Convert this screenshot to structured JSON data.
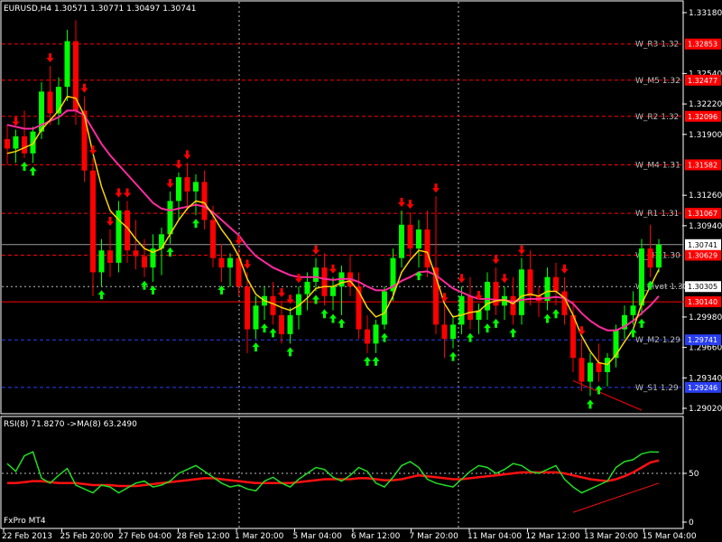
{
  "header": {
    "symbol_info": "EURUSD,H4  1.30571 1.30771 1.30497 1.30741",
    "rsi_info": "RSI(8) 71.8270   ->MA(8) 63.2490",
    "broker": "FxPro MT4"
  },
  "colors": {
    "bull": "#00ff00",
    "bear": "#ff0000",
    "resistance": "#ff0000",
    "support": "#2a3ef0",
    "ma_fast": "#ffd400",
    "ma_slow": "#ff2aa0",
    "rsi_line": "#22dd22",
    "rsi_ma": "#ff1010",
    "grid": "#7a7a7a"
  },
  "chart_data": [
    {
      "type": "candlestick",
      "symbol": "EURUSD",
      "timeframe": "H4",
      "ohlc_current": {
        "open": 1.30571,
        "high": 1.30771,
        "low": 1.30497,
        "close": 1.30741
      },
      "ylim": [
        1.2902,
        1.3318
      ],
      "y_ticks": [
        "1.33180",
        "1.32540",
        "1.32220",
        "1.31900",
        "1.31260",
        "1.30940",
        "1.29980",
        "1.29660",
        "1.29340",
        "1.29020"
      ],
      "x_ticks": [
        "22 Feb 2013",
        "25 Feb 20:00",
        "27 Feb 04:00",
        "28 Feb 12:00",
        "1 Mar 20:00",
        "5 Mar 04:00",
        "6 Mar 12:00",
        "7 Mar 20:00",
        "11 Mar 04:00",
        "12 Mar 12:00",
        "13 Mar 20:00",
        "15 Mar 04:00"
      ],
      "levels": [
        {
          "name": "W_R3 1.32",
          "price": 1.3285,
          "badge": "1.32853",
          "kind": "resistance"
        },
        {
          "name": "W_M5 1.32",
          "price": 1.3247,
          "badge": "1.32477",
          "kind": "resistance"
        },
        {
          "name": "W_R2 1.32",
          "price": 1.3209,
          "badge": "1.32096",
          "kind": "resistance"
        },
        {
          "name": "W_M4 1.31",
          "price": 1.3158,
          "badge": "1.31582",
          "kind": "resistance"
        },
        {
          "name": "W_R1 1.31",
          "price": 1.3107,
          "badge": "1.31067",
          "kind": "resistance"
        },
        {
          "name": "W_M3 1.30",
          "price": 1.3063,
          "badge": "1.30629",
          "kind": "resistance"
        },
        {
          "name": "W_Pivot 1.30",
          "price": 1.303,
          "badge": "1.30305",
          "kind": "pivot"
        },
        {
          "name": "",
          "price": 1.3014,
          "badge": "1.30140",
          "kind": "resistance"
        },
        {
          "name": "W_M2 1.29",
          "price": 1.2974,
          "badge": "1.29741",
          "kind": "support"
        },
        {
          "name": "W_S1 1.29",
          "price": 1.2924,
          "badge": "1.29246",
          "kind": "support"
        }
      ],
      "current_price": {
        "price": 1.30741,
        "badge": "1.30741"
      },
      "candles": [
        {
          "o": 1.3185,
          "h": 1.32,
          "l": 1.3158,
          "c": 1.3175
        },
        {
          "o": 1.3175,
          "h": 1.3195,
          "l": 1.316,
          "c": 1.3188
        },
        {
          "o": 1.3188,
          "h": 1.3215,
          "l": 1.3165,
          "c": 1.317
        },
        {
          "o": 1.317,
          "h": 1.3198,
          "l": 1.316,
          "c": 1.3193
        },
        {
          "o": 1.3193,
          "h": 1.3245,
          "l": 1.3185,
          "c": 1.3235
        },
        {
          "o": 1.3235,
          "h": 1.3262,
          "l": 1.32,
          "c": 1.3212
        },
        {
          "o": 1.3212,
          "h": 1.325,
          "l": 1.32,
          "c": 1.324
        },
        {
          "o": 1.324,
          "h": 1.33,
          "l": 1.3225,
          "c": 1.3288
        },
        {
          "o": 1.3288,
          "h": 1.331,
          "l": 1.32,
          "c": 1.3215
        },
        {
          "o": 1.3215,
          "h": 1.323,
          "l": 1.314,
          "c": 1.3152
        },
        {
          "o": 1.3152,
          "h": 1.3165,
          "l": 1.302,
          "c": 1.3045
        },
        {
          "o": 1.3045,
          "h": 1.308,
          "l": 1.303,
          "c": 1.3068
        },
        {
          "o": 1.3068,
          "h": 1.309,
          "l": 1.304,
          "c": 1.3055
        },
        {
          "o": 1.3055,
          "h": 1.312,
          "l": 1.3045,
          "c": 1.311
        },
        {
          "o": 1.311,
          "h": 1.312,
          "l": 1.3055,
          "c": 1.3068
        },
        {
          "o": 1.3068,
          "h": 1.31,
          "l": 1.3048,
          "c": 1.3062
        },
        {
          "o": 1.3062,
          "h": 1.308,
          "l": 1.304,
          "c": 1.305
        },
        {
          "o": 1.305,
          "h": 1.3085,
          "l": 1.3035,
          "c": 1.307
        },
        {
          "o": 1.307,
          "h": 1.3092,
          "l": 1.3042,
          "c": 1.3085
        },
        {
          "o": 1.3085,
          "h": 1.313,
          "l": 1.3075,
          "c": 1.312
        },
        {
          "o": 1.312,
          "h": 1.315,
          "l": 1.31,
          "c": 1.3145
        },
        {
          "o": 1.3145,
          "h": 1.316,
          "l": 1.311,
          "c": 1.313
        },
        {
          "o": 1.313,
          "h": 1.3148,
          "l": 1.3105,
          "c": 1.314
        },
        {
          "o": 1.314,
          "h": 1.3152,
          "l": 1.309,
          "c": 1.31
        },
        {
          "o": 1.31,
          "h": 1.3115,
          "l": 1.305,
          "c": 1.306
        },
        {
          "o": 1.306,
          "h": 1.3075,
          "l": 1.3035,
          "c": 1.305
        },
        {
          "o": 1.305,
          "h": 1.3065,
          "l": 1.303,
          "c": 1.306
        },
        {
          "o": 1.306,
          "h": 1.307,
          "l": 1.302,
          "c": 1.303
        },
        {
          "o": 1.303,
          "h": 1.3045,
          "l": 1.296,
          "c": 1.2985
        },
        {
          "o": 1.2985,
          "h": 1.302,
          "l": 1.2975,
          "c": 1.301
        },
        {
          "o": 1.301,
          "h": 1.303,
          "l": 1.2995,
          "c": 1.302
        },
        {
          "o": 1.302,
          "h": 1.3035,
          "l": 1.299,
          "c": 1.3
        },
        {
          "o": 1.3,
          "h": 1.3015,
          "l": 1.297,
          "c": 1.298
        },
        {
          "o": 1.298,
          "h": 1.3008,
          "l": 1.297,
          "c": 1.3
        },
        {
          "o": 1.3,
          "h": 1.303,
          "l": 1.2985,
          "c": 1.3022
        },
        {
          "o": 1.3022,
          "h": 1.3045,
          "l": 1.3005,
          "c": 1.3035
        },
        {
          "o": 1.3035,
          "h": 1.306,
          "l": 1.3025,
          "c": 1.305
        },
        {
          "o": 1.305,
          "h": 1.3065,
          "l": 1.301,
          "c": 1.302
        },
        {
          "o": 1.302,
          "h": 1.304,
          "l": 1.3005,
          "c": 1.303
        },
        {
          "o": 1.303,
          "h": 1.3052,
          "l": 1.3,
          "c": 1.3045
        },
        {
          "o": 1.3045,
          "h": 1.3062,
          "l": 1.302,
          "c": 1.303
        },
        {
          "o": 1.303,
          "h": 1.3045,
          "l": 1.2975,
          "c": 1.2985
        },
        {
          "o": 1.2985,
          "h": 1.3,
          "l": 1.296,
          "c": 1.297
        },
        {
          "o": 1.297,
          "h": 1.2995,
          "l": 1.296,
          "c": 1.299
        },
        {
          "o": 1.299,
          "h": 1.303,
          "l": 1.2985,
          "c": 1.3025
        },
        {
          "o": 1.3025,
          "h": 1.307,
          "l": 1.3015,
          "c": 1.306
        },
        {
          "o": 1.306,
          "h": 1.311,
          "l": 1.305,
          "c": 1.3095
        },
        {
          "o": 1.3095,
          "h": 1.3108,
          "l": 1.306,
          "c": 1.307
        },
        {
          "o": 1.307,
          "h": 1.31,
          "l": 1.305,
          "c": 1.309
        },
        {
          "o": 1.309,
          "h": 1.311,
          "l": 1.304,
          "c": 1.305
        },
        {
          "o": 1.305,
          "h": 1.3125,
          "l": 1.298,
          "c": 1.299
        },
        {
          "o": 1.299,
          "h": 1.301,
          "l": 1.2955,
          "c": 1.2975
        },
        {
          "o": 1.2975,
          "h": 1.3,
          "l": 1.2965,
          "c": 1.299
        },
        {
          "o": 1.299,
          "h": 1.303,
          "l": 1.298,
          "c": 1.302
        },
        {
          "o": 1.302,
          "h": 1.304,
          "l": 1.2985,
          "c": 1.2995
        },
        {
          "o": 1.2995,
          "h": 1.3012,
          "l": 1.298,
          "c": 1.3005
        },
        {
          "o": 1.3005,
          "h": 1.3045,
          "l": 1.2995,
          "c": 1.3035
        },
        {
          "o": 1.3035,
          "h": 1.305,
          "l": 1.3,
          "c": 1.301
        },
        {
          "o": 1.301,
          "h": 1.303,
          "l": 1.2995,
          "c": 1.302
        },
        {
          "o": 1.302,
          "h": 1.304,
          "l": 1.299,
          "c": 1.3
        },
        {
          "o": 1.3,
          "h": 1.306,
          "l": 1.299,
          "c": 1.3048
        },
        {
          "o": 1.3048,
          "h": 1.3068,
          "l": 1.301,
          "c": 1.302
        },
        {
          "o": 1.302,
          "h": 1.303,
          "l": 1.2998,
          "c": 1.3015
        },
        {
          "o": 1.3015,
          "h": 1.305,
          "l": 1.3005,
          "c": 1.304
        },
        {
          "o": 1.304,
          "h": 1.3055,
          "l": 1.301,
          "c": 1.3025
        },
        {
          "o": 1.3025,
          "h": 1.304,
          "l": 1.299,
          "c": 1.3
        },
        {
          "o": 1.3,
          "h": 1.3015,
          "l": 1.294,
          "c": 1.2955
        },
        {
          "o": 1.2955,
          "h": 1.2975,
          "l": 1.292,
          "c": 1.293
        },
        {
          "o": 1.293,
          "h": 1.296,
          "l": 1.2915,
          "c": 1.295
        },
        {
          "o": 1.295,
          "h": 1.297,
          "l": 1.293,
          "c": 1.294
        },
        {
          "o": 1.294,
          "h": 1.296,
          "l": 1.2925,
          "c": 1.2955
        },
        {
          "o": 1.2955,
          "h": 1.299,
          "l": 1.2945,
          "c": 1.2985
        },
        {
          "o": 1.2985,
          "h": 1.301,
          "l": 1.2975,
          "c": 1.3
        },
        {
          "o": 1.3,
          "h": 1.3025,
          "l": 1.299,
          "c": 1.301
        },
        {
          "o": 1.301,
          "h": 1.308,
          "l": 1.3,
          "c": 1.307
        },
        {
          "o": 1.307,
          "h": 1.3095,
          "l": 1.304,
          "c": 1.305
        },
        {
          "o": 1.305,
          "h": 1.308,
          "l": 1.3045,
          "c": 1.3074
        }
      ],
      "ma_fast": [
        1.317,
        1.3172,
        1.3176,
        1.318,
        1.3195,
        1.3205,
        1.3215,
        1.323,
        1.3228,
        1.321,
        1.317,
        1.3135,
        1.311,
        1.31,
        1.3092,
        1.308,
        1.307,
        1.3066,
        1.307,
        1.3085,
        1.31,
        1.3112,
        1.312,
        1.3118,
        1.3105,
        1.309,
        1.3078,
        1.3062,
        1.3038,
        1.3022,
        1.3015,
        1.3012,
        1.3008,
        1.3005,
        1.301,
        1.3018,
        1.3028,
        1.303,
        1.303,
        1.3034,
        1.3036,
        1.3025,
        1.3008,
        1.2998,
        1.3002,
        1.302,
        1.3045,
        1.3058,
        1.3068,
        1.3066,
        1.304,
        1.3012,
        1.2998,
        1.3,
        1.3003,
        1.3004,
        1.3012,
        1.3015,
        1.3016,
        1.3012,
        1.302,
        1.3022,
        1.302,
        1.3025,
        1.3025,
        1.3018,
        1.3,
        1.2978,
        1.2962,
        1.295,
        1.2948,
        1.2958,
        1.2972,
        1.2985,
        1.3012,
        1.303,
        1.3048
      ],
      "ma_slow": [
        1.32,
        1.3198,
        1.3196,
        1.3196,
        1.32,
        1.3204,
        1.3208,
        1.3215,
        1.3215,
        1.321,
        1.3195,
        1.318,
        1.3168,
        1.3158,
        1.3148,
        1.3138,
        1.3128,
        1.3118,
        1.3112,
        1.311,
        1.3112,
        1.3114,
        1.3116,
        1.3114,
        1.3108,
        1.31,
        1.3092,
        1.3084,
        1.3072,
        1.3062,
        1.3056,
        1.305,
        1.3046,
        1.3042,
        1.304,
        1.304,
        1.304,
        1.3038,
        1.3037,
        1.3038,
        1.3038,
        1.3035,
        1.303,
        1.3026,
        1.3026,
        1.303,
        1.3036,
        1.304,
        1.3045,
        1.3046,
        1.3042,
        1.3035,
        1.3028,
        1.3024,
        1.302,
        1.3017,
        1.3017,
        1.3016,
        1.3016,
        1.3014,
        1.3016,
        1.3017,
        1.3017,
        1.3018,
        1.3019,
        1.3018,
        1.3012,
        1.3002,
        1.2994,
        1.2988,
        1.2984,
        1.2984,
        1.2988,
        1.2994,
        1.3002,
        1.301,
        1.302
      ],
      "arrows_down": [
        1,
        5,
        9,
        10,
        12,
        13,
        14,
        19,
        20,
        21,
        27,
        28,
        32,
        33,
        34,
        36,
        38,
        46,
        47,
        50,
        51,
        53,
        55,
        57,
        58,
        60,
        65,
        67
      ],
      "arrows_up": [
        2,
        3,
        11,
        16,
        17,
        19,
        22,
        25,
        29,
        30,
        31,
        33,
        36,
        37,
        38,
        39,
        42,
        43,
        44,
        48,
        52,
        54,
        56,
        57,
        59,
        63,
        64,
        68,
        69,
        73,
        74,
        75
      ],
      "trendline": {
        "from": [
          66,
          1.2931
        ],
        "to": [
          74,
          1.29
        ]
      }
    },
    {
      "type": "line",
      "title": "RSI(8) 71.8270   ->MA(8) 63.2490",
      "ylim": [
        0,
        100
      ],
      "y_ticks": [
        "50",
        "0"
      ],
      "series": [
        {
          "name": "RSI(8)",
          "values": [
            60,
            52,
            68,
            72,
            45,
            40,
            48,
            55,
            38,
            34,
            30,
            38,
            36,
            30,
            35,
            40,
            42,
            36,
            38,
            42,
            50,
            54,
            58,
            52,
            46,
            40,
            36,
            38,
            34,
            32,
            42,
            46,
            40,
            36,
            44,
            50,
            56,
            54,
            46,
            42,
            48,
            56,
            52,
            40,
            36,
            46,
            58,
            62,
            56,
            44,
            40,
            38,
            36,
            44,
            52,
            58,
            56,
            50,
            54,
            60,
            58,
            52,
            50,
            54,
            58,
            44,
            36,
            30,
            34,
            38,
            42,
            56,
            62,
            64,
            70,
            72,
            71.8
          ]
        },
        {
          "name": "MA(8)",
          "values": [
            40,
            40,
            41,
            42,
            42,
            41,
            40,
            40,
            40,
            39,
            38,
            38,
            38,
            37,
            37,
            37,
            38,
            39,
            40,
            41,
            42,
            43,
            44,
            45,
            45,
            44,
            43,
            42,
            41,
            40,
            40,
            40,
            40,
            40,
            41,
            42,
            43,
            44,
            44,
            44,
            44,
            45,
            45,
            44,
            43,
            43,
            44,
            46,
            48,
            47,
            46,
            45,
            44,
            44,
            45,
            46,
            47,
            48,
            49,
            50,
            51,
            51,
            51,
            51,
            51,
            50,
            48,
            46,
            44,
            43,
            42,
            44,
            47,
            51,
            56,
            61,
            63.2
          ]
        }
      ],
      "trendline": {
        "from": [
          66,
          10
        ],
        "to": [
          76,
          40
        ]
      }
    }
  ]
}
